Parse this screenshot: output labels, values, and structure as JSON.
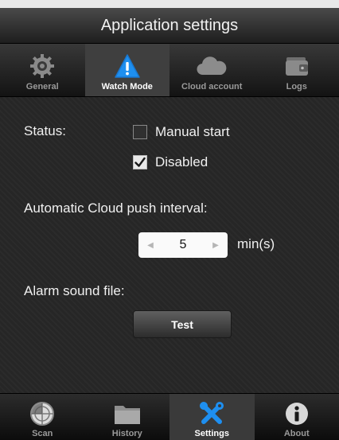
{
  "header": {
    "title": "Application settings"
  },
  "top_tabs": [
    {
      "label": "General",
      "icon": "gear-icon",
      "active": false
    },
    {
      "label": "Watch Mode",
      "icon": "warning-icon",
      "active": true
    },
    {
      "label": "Cloud account",
      "icon": "cloud-icon",
      "active": false
    },
    {
      "label": "Logs",
      "icon": "wallet-icon",
      "active": false
    }
  ],
  "settings": {
    "status_label": "Status:",
    "manual_start": {
      "label": "Manual start",
      "checked": false
    },
    "disabled": {
      "label": "Disabled",
      "checked": true
    },
    "push_interval_label": "Automatic Cloud push interval:",
    "push_interval_value": "5",
    "push_interval_unit": "min(s)",
    "alarm_label": "Alarm sound file:",
    "test_button": "Test"
  },
  "bottom_tabs": [
    {
      "label": "Scan",
      "icon": "scan-icon",
      "active": false
    },
    {
      "label": "History",
      "icon": "folder-icon",
      "active": false
    },
    {
      "label": "Settings",
      "icon": "tools-icon",
      "active": true
    },
    {
      "label": "About",
      "icon": "info-icon",
      "active": false
    }
  ],
  "colors": {
    "accent_blue": "#1e8ff0",
    "background": "#262626"
  }
}
